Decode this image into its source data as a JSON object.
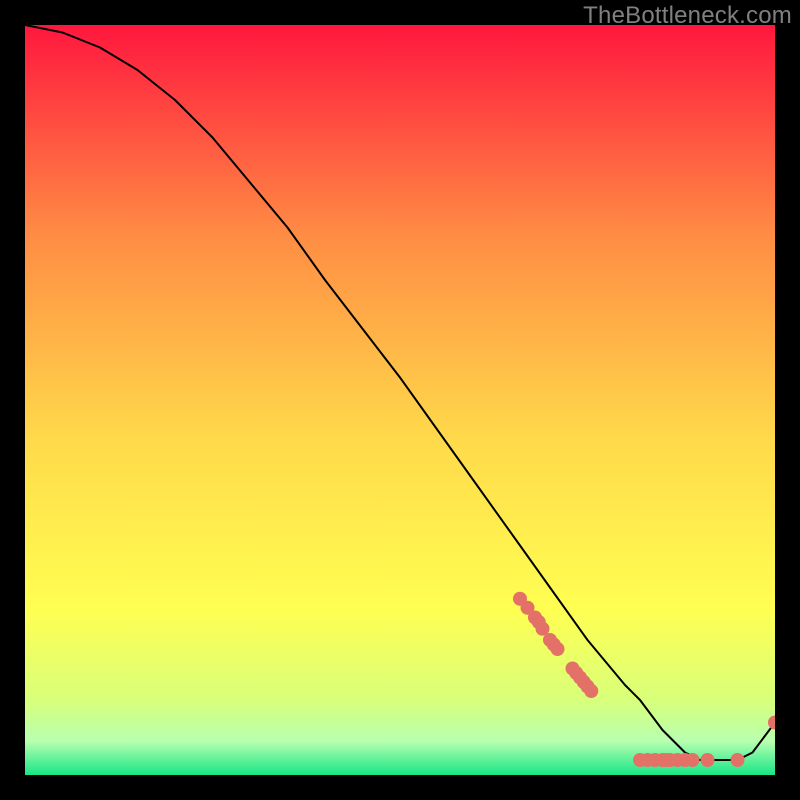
{
  "watermark": "TheBottleneck.com",
  "chart_data": {
    "type": "line",
    "title": "",
    "xlabel": "",
    "ylabel": "",
    "xlim": [
      0,
      100
    ],
    "ylim": [
      0,
      100
    ],
    "curve": {
      "name": "bottleneck-curve",
      "x": [
        0,
        5,
        10,
        15,
        20,
        25,
        30,
        35,
        40,
        45,
        50,
        55,
        60,
        65,
        70,
        75,
        80,
        82,
        85,
        88,
        90,
        92,
        95,
        97,
        100
      ],
      "y": [
        100,
        99,
        97,
        94,
        90,
        85,
        79,
        73,
        66,
        59.5,
        53,
        46,
        39,
        32,
        25,
        18,
        12,
        10,
        6,
        3,
        2,
        2,
        2,
        3,
        7
      ]
    },
    "highlight_points": {
      "name": "scatter-cluster",
      "x": [
        66,
        67,
        68,
        68.5,
        69,
        70,
        70.5,
        71,
        73,
        73.5,
        74,
        74.5,
        75,
        75.5,
        82,
        83,
        84,
        85,
        85.5,
        86,
        87,
        88,
        89,
        91,
        95,
        100
      ],
      "y": [
        23.5,
        22.3,
        21,
        20.4,
        19.5,
        18,
        17.4,
        16.8,
        14.2,
        13.6,
        13,
        12.4,
        11.8,
        11.2,
        2,
        2,
        2,
        2,
        2,
        2,
        2,
        2,
        2,
        2,
        2,
        7
      ]
    },
    "point_color": "#e37168",
    "gradient_top": "#ff173e",
    "gradient_mid_upper": "#ff8c44",
    "gradient_mid": "#ffd94a",
    "gradient_mid_lower": "#ffff52",
    "gradient_low": "#d8ff7a",
    "gradient_bottom_band_top": "#b7ffb0",
    "gradient_bottom": "#17e686"
  }
}
